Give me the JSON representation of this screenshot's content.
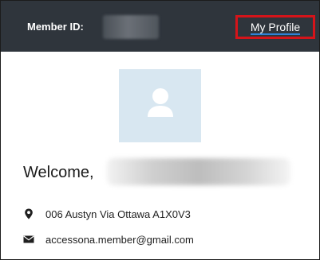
{
  "header": {
    "member_label": "Member ID:",
    "profile_link": "My Profile"
  },
  "profile": {
    "welcome": "Welcome,",
    "address": "006 Austyn Via Ottawa A1X0V3",
    "email": "accessona.member@gmail.com"
  },
  "icons": {
    "avatar": "user-placeholder-icon",
    "address": "map-marker-icon",
    "email": "envelope-icon"
  },
  "colors": {
    "header_bg": "#2f353c",
    "highlight_box": "#d5141a",
    "link_underline": "#2f82d6",
    "avatar_bg": "#d8e7f1"
  }
}
